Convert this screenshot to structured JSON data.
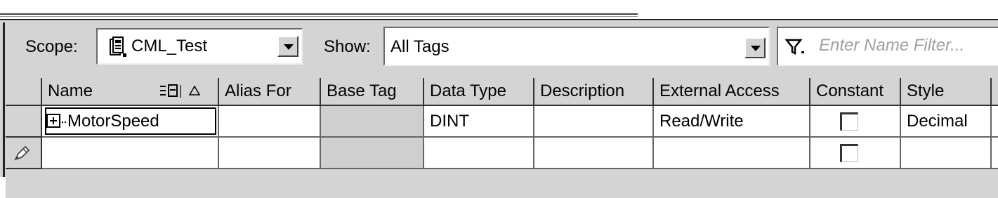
{
  "toolbar": {
    "scope_label": "Scope:",
    "scope_value": "CML_Test",
    "show_label": "Show:",
    "show_value": "All Tags",
    "filter_placeholder": "Enter Name Filter..."
  },
  "table": {
    "columns": [
      "Name",
      "Alias For",
      "Base Tag",
      "Data Type",
      "Description",
      "External Access",
      "Constant",
      "Style"
    ],
    "rows": [
      {
        "name": "MotorSpeed",
        "alias_for": "",
        "base_tag": "",
        "data_type": "DINT",
        "description": "",
        "external_access": "Read/Write",
        "constant": false,
        "style": "Decimal"
      },
      {
        "name": "",
        "alias_for": "",
        "base_tag": "",
        "data_type": "",
        "description": "",
        "external_access": "",
        "constant": false,
        "style": ""
      }
    ]
  },
  "icons": [
    "controller-icon",
    "dropdown-arrow-icon",
    "filter-icon",
    "sort-ascending-icon",
    "expand-plus-icon",
    "pencil-edit-icon"
  ],
  "colors": {
    "panel": "#d4d4d4",
    "cell_gray": "#cfcfcf",
    "placeholder": "#a0a0a0"
  }
}
